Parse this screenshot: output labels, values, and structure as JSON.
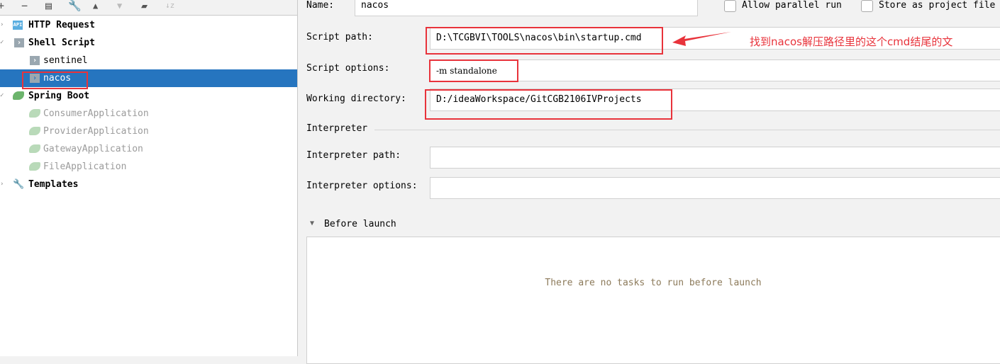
{
  "toolbar": {
    "icons": [
      "plus-icon",
      "minus-icon",
      "copy-icon",
      "wrench-icon",
      "arrow-up-icon",
      "arrow-down-icon",
      "new-folder-icon",
      "sort-az-icon"
    ]
  },
  "tree": {
    "http": "HTTP Request",
    "shell": "Shell Script",
    "sentinel": "sentinel",
    "nacos": "nacos",
    "spring": "Spring Boot",
    "consumer": "ConsumerApplication",
    "provider": "ProviderApplication",
    "gateway": "GatewayApplication",
    "file": "FileApplication",
    "templates": "Templates"
  },
  "form": {
    "name_label": "Name:",
    "name_value": "nacos",
    "allow_parallel": "Allow parallel run",
    "store_project": "Store as project file",
    "script_path_label": "Script path:",
    "script_path_value": "D:\\TCGBVI\\TOOLS\\nacos\\bin\\startup.cmd",
    "script_options_label": "Script options:",
    "script_options_value": "-m standalone",
    "working_dir_label": "Working directory:",
    "working_dir_value": "D:/ideaWorkspace/GitCGB2106IVProjects",
    "interpreter_section": "Interpreter",
    "interpreter_path_label": "Interpreter path:",
    "interpreter_path_value": "",
    "interpreter_options_label": "Interpreter options:",
    "interpreter_options_value": "",
    "before_launch": "Before launch",
    "no_tasks": "There are no tasks to run before launch"
  },
  "annotation": {
    "text": "找到nacos解压路径里的这个cmd结尾的文",
    "color": "#e8333b"
  },
  "colors": {
    "selection": "#2675bf",
    "highlight_box": "#e8333b"
  }
}
